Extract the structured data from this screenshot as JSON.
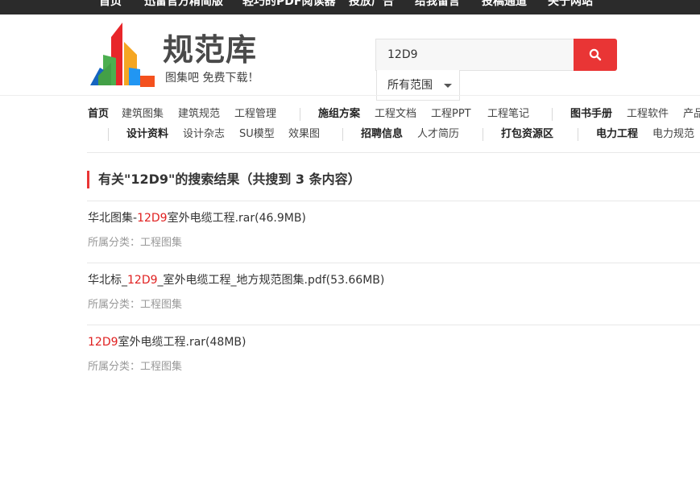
{
  "topnav": [
    "首页",
    "迅雷官方精简版",
    "轻巧的PDF阅读器",
    "投放广告",
    "给我留言",
    "投稿通道",
    "关于网站"
  ],
  "logo": {
    "title": "规范库",
    "slogan": "图集吧  免费下载！"
  },
  "search": {
    "value": "12D9",
    "scope": "所有范围"
  },
  "nav_row1": {
    "g1": [
      "首页",
      "建筑图集",
      "建筑规范",
      "工程管理"
    ],
    "g2": [
      "施组方案",
      "工程文档",
      "工程PPT",
      "工程笔记"
    ],
    "g3": [
      "图书手册",
      "工程软件",
      "产品"
    ]
  },
  "nav_row2": {
    "g1": [
      "设计资料",
      "设计杂志",
      "SU模型",
      "效果图"
    ],
    "g2": [
      "招聘信息",
      "人才简历"
    ],
    "g3": [
      "打包资源区"
    ],
    "g4": [
      "电力工程",
      "电力规范"
    ]
  },
  "results_heading": "有关\"12D9\"的搜索结果（共搜到 3 条内容）",
  "results": [
    {
      "pre": "华北图集-",
      "hl": "12D9",
      "post": "室外电缆工程.rar(46.9MB)",
      "category": "所属分类：工程图集"
    },
    {
      "pre": "华北标_",
      "hl": "12D9",
      "post": "_室外电缆工程_地方规范图集.pdf(53.66MB)",
      "category": "所属分类：工程图集"
    },
    {
      "pre": "",
      "hl": "12D9",
      "post": "室外电缆工程.rar(48MB)",
      "category": "所属分类：工程图集"
    }
  ],
  "colors": {
    "accent": "#e93535",
    "highlight": "#e02020",
    "topbar": "#2b2b2b"
  }
}
